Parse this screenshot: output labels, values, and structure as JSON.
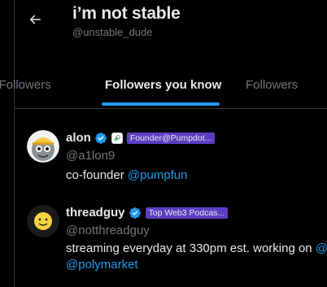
{
  "header": {
    "title": "i’m not stable",
    "handle": "@unstable_dude"
  },
  "tabs": [
    {
      "label": "d Followers",
      "active": false
    },
    {
      "label": "Followers you know",
      "active": true
    },
    {
      "label": "Followers",
      "active": false
    }
  ],
  "users": [
    {
      "name": "alon",
      "verified": true,
      "affiliate_icon": "pump-pill-icon",
      "badge": "Founder@Pumpdot...",
      "handle": "@a1lon9",
      "bio_text": "co-founder ",
      "bio_link": "@pumpfun"
    },
    {
      "name": "threadguy",
      "verified": true,
      "badge": "Top Web3 Podcas...",
      "handle": "@notthreadguy",
      "bio_line1": "streaming everyday at 330pm est. working on ",
      "bio_line1_link": "@",
      "bio_line2_link": "@polymarket"
    }
  ],
  "colors": {
    "background": "#000000",
    "accent": "#1d9bf0",
    "badge": "#5c3ec2",
    "muted": "#71767b",
    "text": "#e7e9ea"
  }
}
